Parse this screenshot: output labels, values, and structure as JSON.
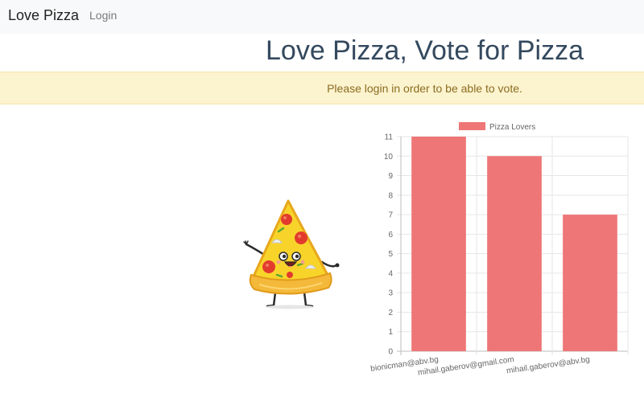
{
  "navbar": {
    "brand": "Love Pizza",
    "login_label": "Login"
  },
  "page": {
    "title": "Love Pizza, Vote for Pizza"
  },
  "alert": {
    "message": "Please login in order to be able to vote."
  },
  "illustration": {
    "icon": "pizza-slice-mascot-icon"
  },
  "colors": {
    "bar": "#ee7676",
    "title": "#34495e",
    "alert_bg": "#fcf3cf",
    "alert_text": "#8a6d1f"
  },
  "chart_data": {
    "type": "bar",
    "title": "",
    "xlabel": "",
    "ylabel": "",
    "categories": [
      "bionicman@abv.bg",
      "mihail.gaberov@gmail.com",
      "mihail.gaberov@abv.bg"
    ],
    "series": [
      {
        "name": "Pizza Lovers",
        "values": [
          11,
          10,
          7
        ]
      }
    ],
    "ylim": [
      0,
      11
    ],
    "yticks": [
      "0",
      "1",
      "2",
      "3",
      "4",
      "5",
      "6",
      "7",
      "8",
      "9",
      "10",
      "11"
    ],
    "grid": true,
    "legend": "top-center"
  }
}
